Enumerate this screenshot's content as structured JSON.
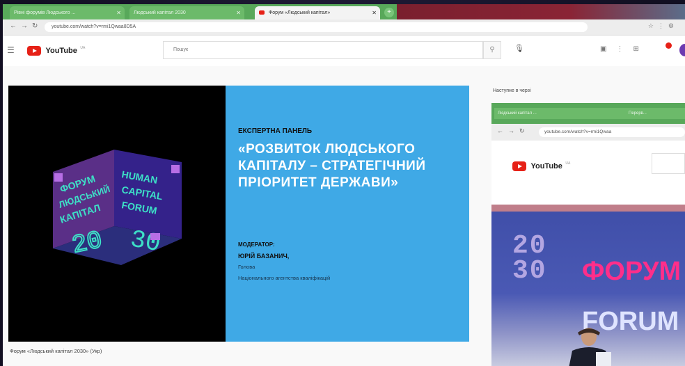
{
  "tabs": [
    {
      "label": "Рівні форумів Людського ...",
      "active": false
    },
    {
      "label": "Людський капітал 2030",
      "active": false
    },
    {
      "label": "Форум «Людський капітал»",
      "active": true
    }
  ],
  "address": {
    "url": "youtube.com/watch?v=rmi1Qwaa8D5A"
  },
  "youtube": {
    "logo_text": "YouTube",
    "logo_sup": "UA",
    "search_placeholder": "Пошук"
  },
  "slide": {
    "kind": "ЕКСПЕРТНА ПАНЕЛЬ",
    "title": "«РОЗВИТОК ЛЮДСЬКОГО\nКАПІТАЛУ – СТРАТЕГІЧНИЙ\nПРІОРИТЕТ ДЕРЖАВИ»",
    "moderator_label": "МОДЕРАТОР:",
    "moderator_name": "ЮРІЙ БАЗАНИЧ,",
    "moderator_role": "Голова",
    "moderator_org": "Національного агентства кваліфікацій",
    "cube_words": [
      "ФОРУМ",
      "ЛЮДСЬКИЙ",
      "КАПІТАЛ",
      "HUMAN",
      "CAPITAL",
      "FORUM",
      "20",
      "30"
    ]
  },
  "caption": "Форум «Людський капітал 2030» (Укр)",
  "sidebar": {
    "heading": "Наступне в черзі"
  },
  "overlay_window": {
    "tabs": [
      "Людський капітал ...",
      "Перерв..."
    ],
    "url": "youtube.com/watch?v=rmi1Qwaa",
    "logo_text": "YouTube",
    "logo_sup": "UA",
    "stage_left": "20\n30",
    "stage_right_1": "ФОРУМ",
    "stage_right_2": "FORUM"
  }
}
